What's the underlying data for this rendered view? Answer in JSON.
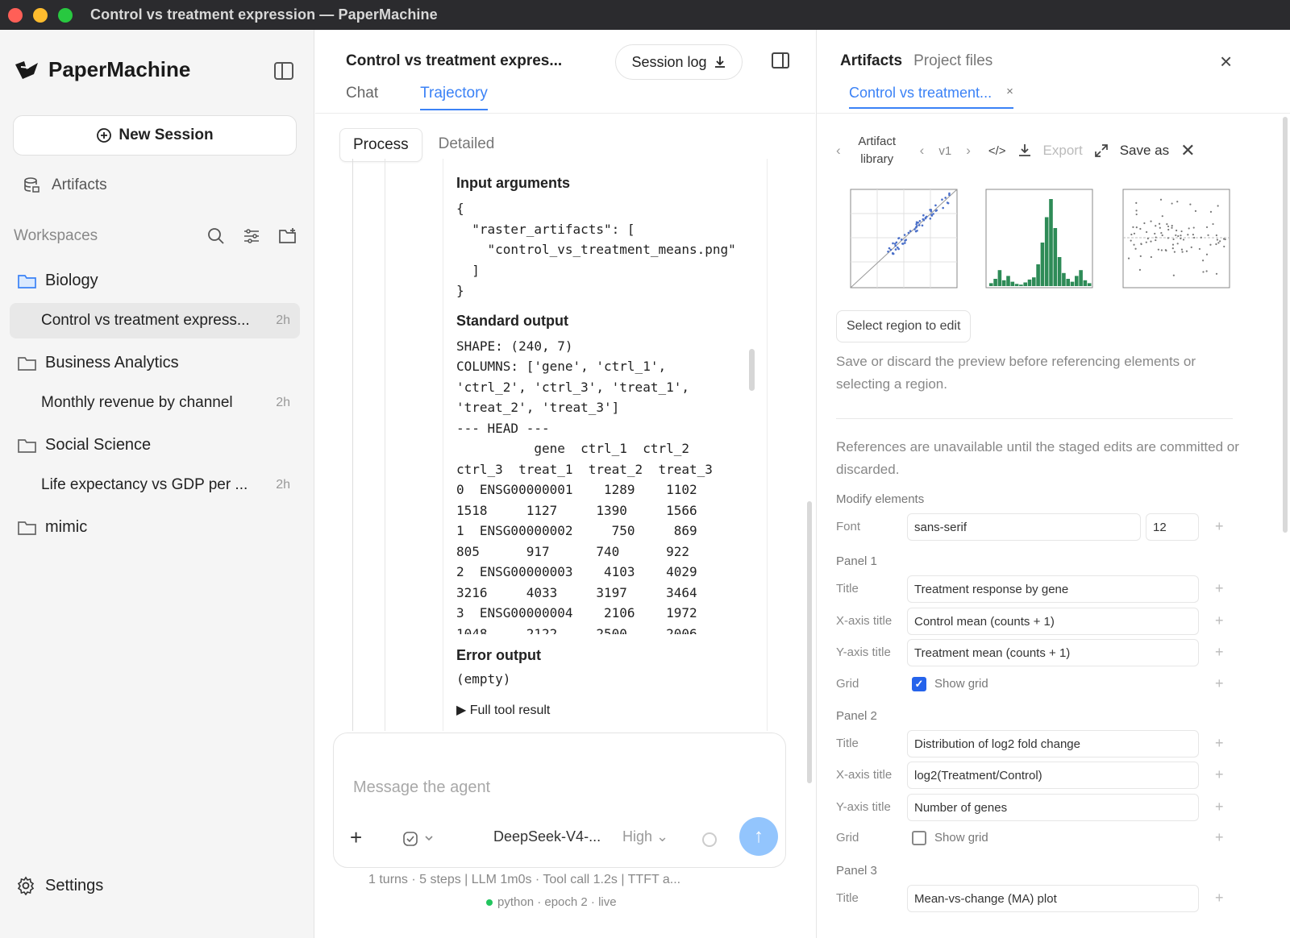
{
  "window": {
    "title": "Control vs treatment expression — PaperMachine"
  },
  "sidebar": {
    "brand": "PaperMachine",
    "new_session": "New Session",
    "artifacts": "Artifacts",
    "workspaces_label": "Workspaces",
    "folders": [
      {
        "name": "Biology",
        "sessions": [
          {
            "title": "Control vs treatment express...",
            "age": "2h"
          }
        ]
      },
      {
        "name": "Business Analytics",
        "sessions": [
          {
            "title": "Monthly revenue by channel",
            "age": "2h"
          }
        ]
      },
      {
        "name": "Social Science",
        "sessions": [
          {
            "title": "Life expectancy vs GDP per ...",
            "age": "2h"
          }
        ]
      },
      {
        "name": "mimic",
        "sessions": []
      }
    ],
    "settings": "Settings"
  },
  "center": {
    "title": "Control vs treatment expres...",
    "session_log": "Session log",
    "tabs": [
      "Chat",
      "Trajectory"
    ],
    "modes": [
      "Process",
      "Detailed"
    ],
    "input_heading": "Input arguments",
    "input_code": "{\n  \"raster_artifacts\": [\n    \"control_vs_treatment_means.png\"\n  ]\n}",
    "stdout_heading": "Standard output",
    "stdout_code": "SHAPE: (240, 7)\nCOLUMNS: ['gene', 'ctrl_1',\n'ctrl_2', 'ctrl_3', 'treat_1',\n'treat_2', 'treat_3']\n--- HEAD ---\n          gene  ctrl_1  ctrl_2\nctrl_3  treat_1  treat_2  treat_3\n0  ENSG00000001    1289    1102\n1518     1127     1390     1566\n1  ENSG00000002     750     869\n805      917      740      922\n2  ENSG00000003    4103    4029\n3216     4033     3197     3464\n3  ENSG00000004    2106    1972\n1048     2122     2500     2006",
    "error_heading": "Error output",
    "error_code": "(empty)",
    "full_result": "Full tool result",
    "composer_placeholder": "Message the agent",
    "model": "DeepSeek-V4-...",
    "effort": "High",
    "stats": "1 turns · 5 steps   |   LLM 1m0s · Tool call 1.2s   |   TTFT a...",
    "live": "python · epoch 2 · live"
  },
  "right": {
    "tabs": [
      "Artifacts",
      "Project files"
    ],
    "file_tab": "Control vs treatment...",
    "toolbar": {
      "library": "Artifact library",
      "version": "v1",
      "export": "Export",
      "save_as": "Save as"
    },
    "select_region": "Select region to edit",
    "note1": "Save or discard the preview before referencing elements or selecting a region.",
    "note2": "References are unavailable until the staged edits are committed or discarded.",
    "modify_heading": "Modify elements",
    "font_label": "Font",
    "font_value": "sans-serif",
    "font_size": "12",
    "panels": [
      {
        "heading": "Panel 1",
        "title": "Treatment response by gene",
        "x": "Control mean (counts + 1)",
        "y": "Treatment mean (counts + 1)",
        "grid": true
      },
      {
        "heading": "Panel 2",
        "title": "Distribution of log2 fold change",
        "x": "log2(Treatment/Control)",
        "y": "Number of genes",
        "grid": false
      },
      {
        "heading": "Panel 3",
        "title": "Mean-vs-change (MA) plot"
      }
    ],
    "labels": {
      "title": "Title",
      "x": "X-axis title",
      "y": "Y-axis title",
      "grid": "Grid",
      "show_grid": "Show grid"
    }
  },
  "colors": {
    "accent": "#3b82f6",
    "send": "#93c5fd",
    "hist": "#2e8b57",
    "live": "#22c55e"
  }
}
